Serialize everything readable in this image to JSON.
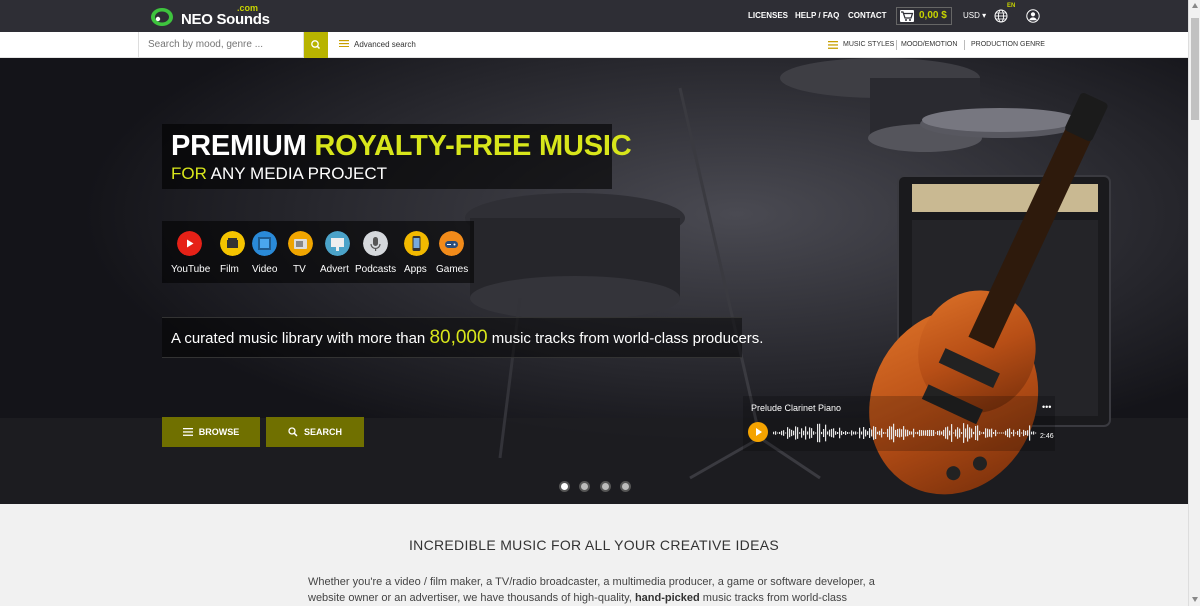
{
  "header": {
    "logo_com": ".com",
    "logo_text": "NEO Sounds",
    "nav": [
      "LICENSES",
      "HELP / FAQ",
      "CONTACT"
    ],
    "cart_amount": "0,00 $",
    "currency": "USD ▾",
    "language": "EN"
  },
  "searchbar": {
    "placeholder": "Search by mood, genre ...",
    "advanced": "Advanced search",
    "categories": [
      "MUSIC STYLES",
      "MOOD/EMOTION",
      "PRODUCTION GENRE"
    ]
  },
  "hero": {
    "headline_plain": "PREMIUM ",
    "headline_accent": "ROYALTY-FREE MUSIC",
    "sub_accent": "FOR",
    "sub_plain": " ANY MEDIA PROJECT",
    "media": [
      {
        "label": "YouTube",
        "icon": "youtube-icon",
        "color": "#e62117"
      },
      {
        "label": "Film",
        "icon": "film-icon",
        "color": "#f5c400"
      },
      {
        "label": "Video",
        "icon": "video-icon",
        "color": "#2a8ad8"
      },
      {
        "label": "TV",
        "icon": "tv-icon",
        "color": "#f0a500"
      },
      {
        "label": "Advert",
        "icon": "advert-icon",
        "color": "#4ba3c9"
      },
      {
        "label": "Podcasts",
        "icon": "podcast-icon",
        "color": "#d5d8dc"
      },
      {
        "label": "Apps",
        "icon": "apps-icon",
        "color": "#f2b900"
      },
      {
        "label": "Games",
        "icon": "games-icon",
        "color": "#f28b1a"
      }
    ],
    "tagline_before": "A curated music library with more than ",
    "tagline_count": "80,000",
    "tagline_after": " music tracks from world-class producers.",
    "browse_label": "BROWSE",
    "search_label": "SEARCH",
    "player": {
      "title": "Prelude Clarinet Piano",
      "menu": "•••",
      "duration": "2:46"
    },
    "slides": 4,
    "active_slide": 0
  },
  "content": {
    "title": "INCREDIBLE MUSIC FOR ALL YOUR CREATIVE IDEAS",
    "text_before": "Whether you're a video / film maker, a TV/radio broadcaster, a multimedia producer, a game or software developer, a website owner or an advertiser, we have thousands of high-quality, ",
    "text_bold": "hand-picked",
    "text_after": " music tracks from world-class"
  },
  "colors": {
    "accent": "#d8e61b",
    "topbar": "#2e2e35",
    "button": "#707000",
    "search_button": "#b8b400",
    "play": "#f5a300"
  }
}
